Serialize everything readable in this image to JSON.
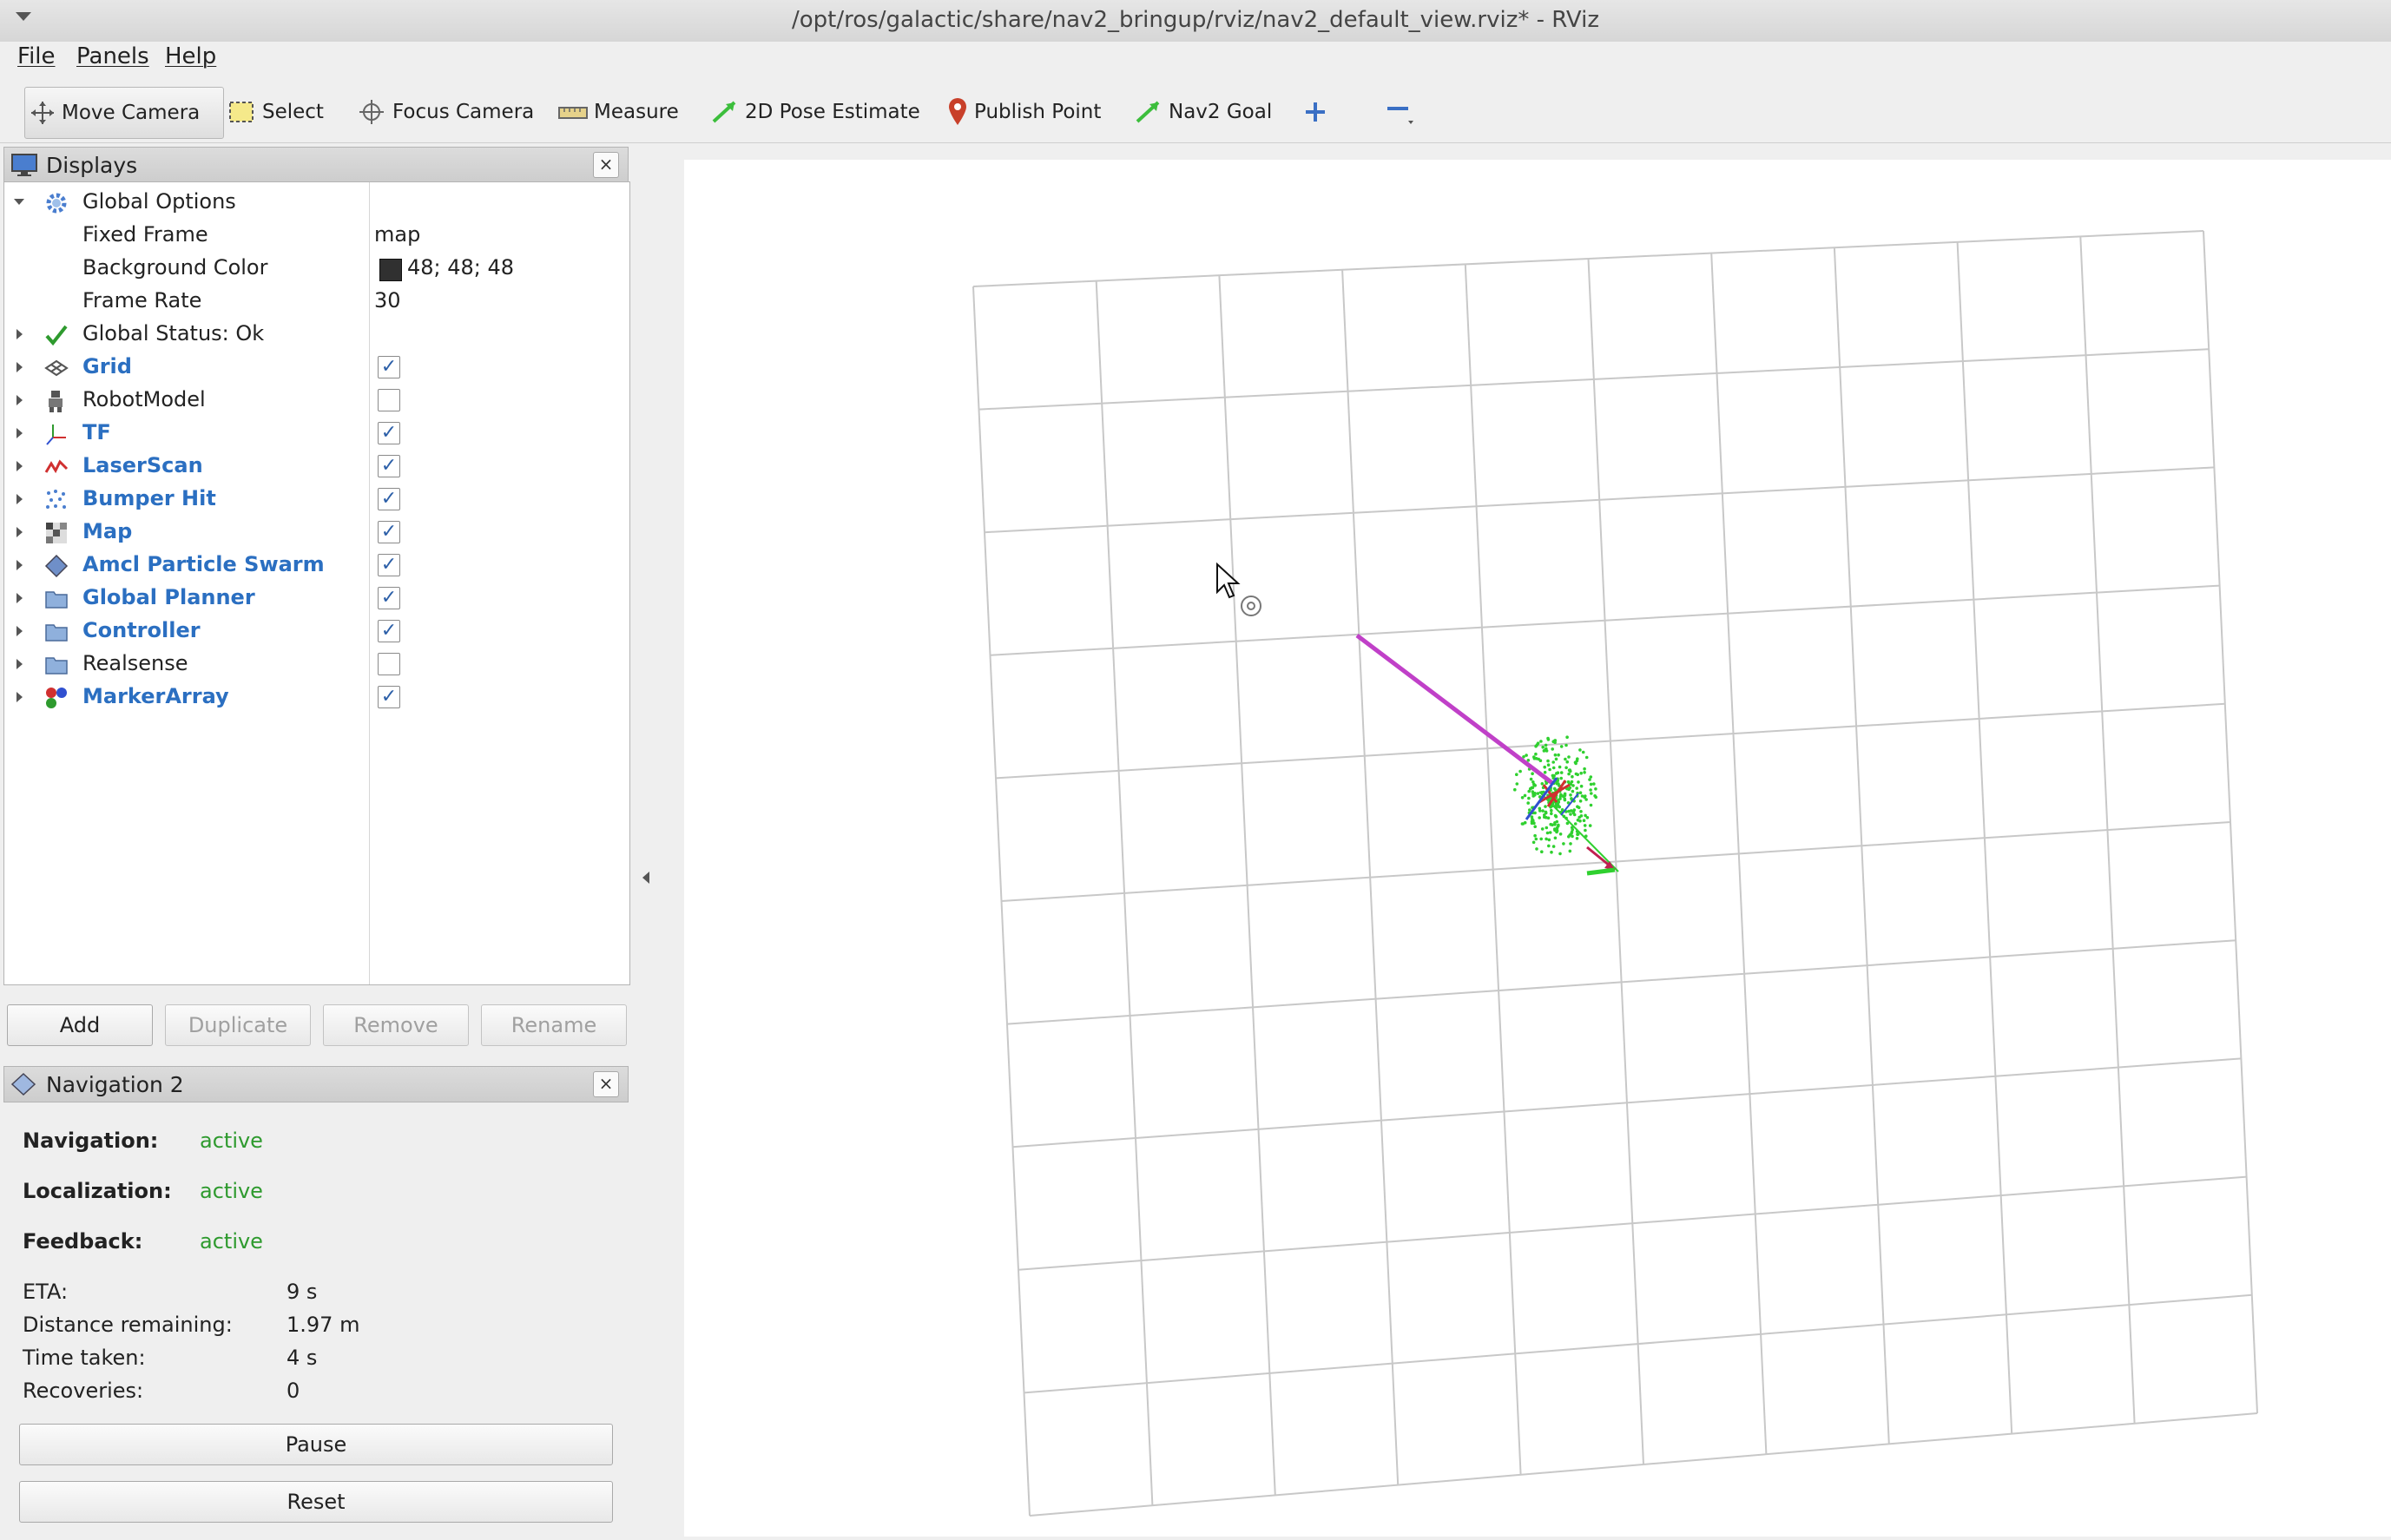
{
  "window": {
    "title": "/opt/ros/galactic/share/nav2_bringup/rviz/nav2_default_view.rviz* - RViz"
  },
  "menu": [
    "File",
    "Panels",
    "Help"
  ],
  "toolbar": {
    "move_camera": "Move Camera",
    "select": "Select",
    "focus_camera": "Focus Camera",
    "measure": "Measure",
    "pose_estimate": "2D Pose Estimate",
    "publish_point": "Publish Point",
    "nav2_goal": "Nav2 Goal"
  },
  "displays": {
    "title": "Displays",
    "global_options": "Global Options",
    "fixed_frame": {
      "label": "Fixed Frame",
      "value": "map"
    },
    "background_color": {
      "label": "Background Color",
      "value": "48; 48; 48",
      "swatch": "#303030"
    },
    "frame_rate": {
      "label": "Frame Rate",
      "value": "30"
    },
    "global_status": "Global Status: Ok",
    "items": [
      {
        "label": "Grid",
        "checked": true
      },
      {
        "label": "RobotModel",
        "checked": false
      },
      {
        "label": "TF",
        "checked": true
      },
      {
        "label": "LaserScan",
        "checked": true
      },
      {
        "label": "Bumper Hit",
        "checked": true
      },
      {
        "label": "Map",
        "checked": true
      },
      {
        "label": "Amcl Particle Swarm",
        "checked": true
      },
      {
        "label": "Global Planner",
        "checked": true
      },
      {
        "label": "Controller",
        "checked": true
      },
      {
        "label": "Realsense",
        "checked": false
      },
      {
        "label": "MarkerArray",
        "checked": true
      }
    ],
    "buttons": {
      "add": "Add",
      "duplicate": "Duplicate",
      "remove": "Remove",
      "rename": "Rename"
    }
  },
  "navigation": {
    "title": "Navigation 2",
    "navigation": {
      "label": "Navigation:",
      "value": "active"
    },
    "localization": {
      "label": "Localization:",
      "value": "active"
    },
    "feedback": {
      "label": "Feedback:",
      "value": "active"
    },
    "eta": {
      "label": "ETA:",
      "value": "9 s"
    },
    "distance": {
      "label": "Distance remaining:",
      "value": "1.97 m"
    },
    "time_taken": {
      "label": "Time taken:",
      "value": "4 s"
    },
    "recoveries": {
      "label": "Recoveries:",
      "value": "0"
    },
    "pause": "Pause",
    "reset": "Reset"
  },
  "colors": {
    "accent_blue": "#2b6fc1",
    "status_green": "#2e9a2e",
    "path_magenta": "#c040c8",
    "particle_green": "#22cc22"
  }
}
